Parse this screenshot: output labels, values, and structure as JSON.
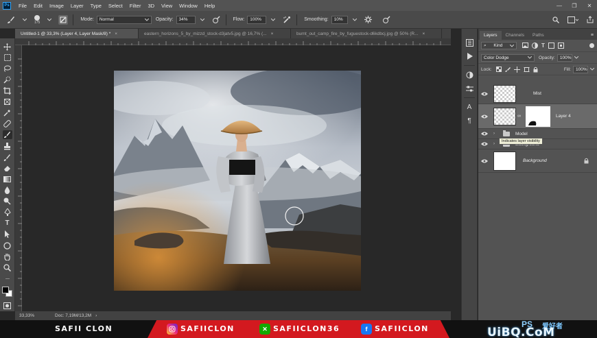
{
  "app": {
    "logo": "Ps"
  },
  "menu": [
    "File",
    "Edit",
    "Image",
    "Layer",
    "Type",
    "Select",
    "Filter",
    "3D",
    "View",
    "Window",
    "Help"
  ],
  "window_controls": {
    "minimize": "—",
    "maximize": "❐",
    "close": "✕"
  },
  "options": {
    "brush_size": "175",
    "mode_label": "Mode:",
    "mode_value": "Normal",
    "opacity_label": "Opacity:",
    "opacity_value": "34%",
    "flow_label": "Flow:",
    "flow_value": "100%",
    "smoothing_label": "Smoothing:",
    "smoothing_value": "10%"
  },
  "doc_tabs": [
    {
      "label": "Untitled-1 @ 33,3% (Layer 4, Layer Mask/8) *",
      "active": true
    },
    {
      "label": "eastern_horizons_5_by_mizzd_stock-d3jatv5.jpg @ 16,7% (...",
      "active": false
    },
    {
      "label": "burnt_out_camp_fire_by_fuguestock-d6kdbcj.jpg @ 50% (R...",
      "active": false
    }
  ],
  "status": {
    "zoom": "33,33%",
    "doc": "Doc: 7,19M/13,2M"
  },
  "layers_panel": {
    "tabs": [
      "Layers",
      "Channels",
      "Paths"
    ],
    "kind_label": "Kind",
    "blend_mode": "Color Dodge",
    "opacity_label": "Opacity:",
    "opacity_value": "100%",
    "lock_label": "Lock:",
    "fill_label": "Fill:",
    "fill_value": "100%",
    "layers": [
      {
        "name": "Mist"
      },
      {
        "name": "Layer 4"
      },
      {
        "name": "Model"
      },
      {
        "name": "Background"
      },
      {
        "name": "Background"
      }
    ],
    "tooltip": "Indicates layer visibility"
  },
  "banner": {
    "brand": "SAFII CLON",
    "instagram": "SAFIICLON",
    "upwork": "SAFIICLON36",
    "facebook": "SAFIICLON",
    "watermark": "UiBQ.CoM",
    "watermark_ps": "PS",
    "watermark_cn": "爱好者"
  },
  "colors": {
    "accent": "#31a8ff",
    "banner_red": "#d3191f",
    "panel_bg": "#535353"
  }
}
